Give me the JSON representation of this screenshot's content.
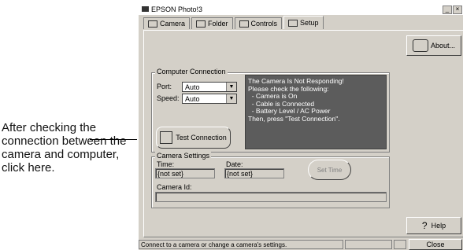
{
  "callout": {
    "text": "After checking the connection between the camera and computer, click here."
  },
  "window": {
    "title": "EPSON Photo!3",
    "minimize_label": "_",
    "close_label": "×"
  },
  "tabs": [
    {
      "label": "Camera"
    },
    {
      "label": "Folder"
    },
    {
      "label": "Controls"
    },
    {
      "label": "Setup"
    }
  ],
  "about_button": {
    "label": "About..."
  },
  "computer_connection": {
    "legend": "Computer Connection",
    "port_label": "Port:",
    "port_value": "Auto",
    "speed_label": "Speed:",
    "speed_value": "Auto",
    "message_lines": [
      "The Camera Is Not Responding!",
      "",
      "Please check the following:",
      "  - Camera is On",
      "  - Cable is Connected",
      "  - Battery Level / AC Power",
      "Then, press \"Test Connection\"."
    ],
    "test_button": "Test Connection"
  },
  "camera_settings": {
    "legend": "Camera Settings",
    "time_label": "Time:",
    "time_value": "{not set}",
    "date_label": "Date:",
    "date_value": "{not set}",
    "set_time_label": "Set Time",
    "camera_id_label": "Camera Id:",
    "camera_id_value": ""
  },
  "help_button": {
    "label": "Help"
  },
  "close_button": {
    "label": "Close"
  },
  "status_bar": {
    "text": "Connect to a camera or change a camera's settings."
  }
}
